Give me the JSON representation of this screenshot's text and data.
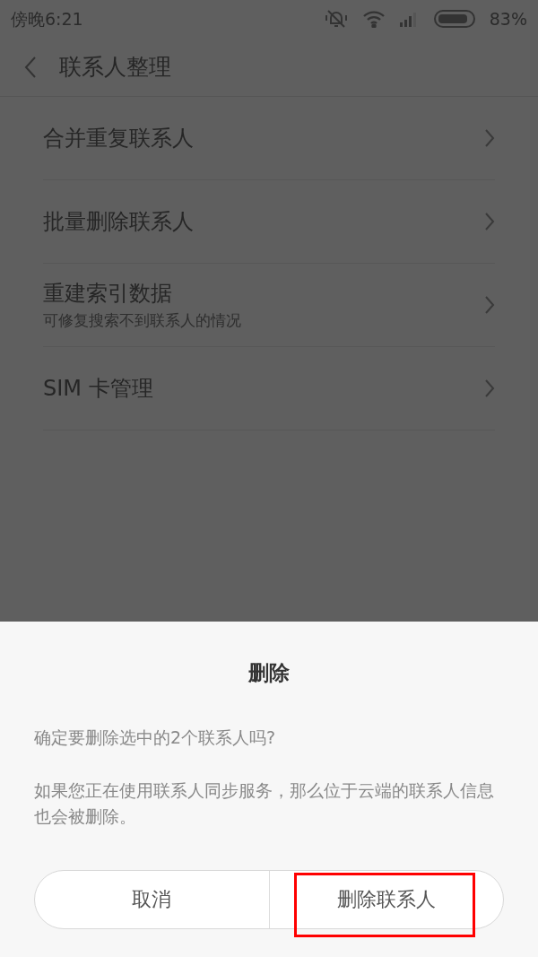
{
  "status_bar": {
    "time": "傍晚6:21",
    "battery": "83%"
  },
  "header": {
    "title": "联系人整理"
  },
  "items": [
    {
      "title": "合并重复联系人"
    },
    {
      "title": "批量删除联系人"
    },
    {
      "title": "重建索引数据",
      "subtitle": "可修复搜索不到联系人的情况"
    },
    {
      "title": "SIM 卡管理"
    }
  ],
  "dialog": {
    "title": "删除",
    "message": "确定要删除选中的2个联系人吗?",
    "note": "如果您正在使用联系人同步服务，那么位于云端的联系人信息也会被删除。",
    "buttons": [
      {
        "label": "取消",
        "highlighted": false
      },
      {
        "label": "删除联系人",
        "highlighted": true
      }
    ]
  }
}
